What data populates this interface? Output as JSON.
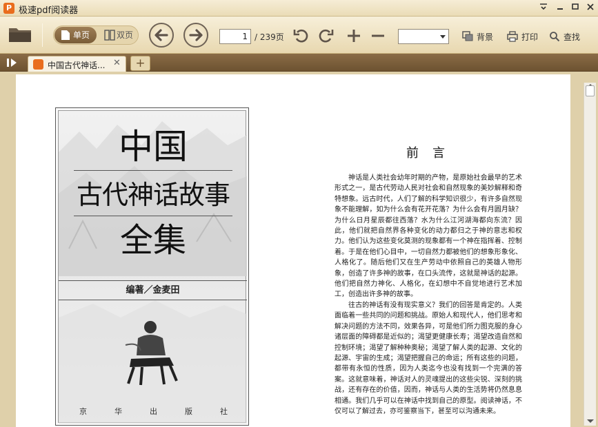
{
  "app": {
    "title": "极速pdf阅读器",
    "logo_color": "#e96d1d"
  },
  "window_controls": [
    "menu-icon",
    "minimize-icon",
    "maximize-icon",
    "close-icon"
  ],
  "toolbar": {
    "single_page_label": "单页",
    "double_page_label": "双页",
    "current_page": "1",
    "total_pages_label": "/ 239页",
    "background_label": "背景",
    "print_label": "打印",
    "find_label": "查找",
    "zoom_value": ""
  },
  "tabs": [
    {
      "label": "中国古代神话...",
      "active": true
    }
  ],
  "tab_add_label": "+",
  "document": {
    "cover": {
      "title_line1": "中国",
      "title_line2": "古代神话故事",
      "title_line3": "全集",
      "author": "编著／金麦田",
      "publisher_chars": [
        "京",
        "华",
        "出",
        "版",
        "社"
      ]
    },
    "preface": {
      "title": "前言",
      "paragraphs": [
        "神话是人类社会幼年时期的产物，是原始社会最早的艺术形式之一，是古代劳动人民对社会和自然现象的美妙解释和奇特想象。远古时代，人们了解的科学知识很少，有许多自然现象不能理解，如为什么会有花开花落？为什么会有月圆月缺？为什么日月星辰都往西落？水为什么江河湖海都向东流？因此，他们就把自然界各种变化的动力都归之于神的意志和权力。他们认为这些变化莫测的现象都有一个神在指挥着、控制着。于是在他们心目中，一切自然力都被他们的想象形象化、人格化了。随后他们又在生产劳动中依照自己的英雄人物形象，创造了许多神的故事，在口头流传，这就是神话的起源。他们把自然力神化、人格化，在幻想中不自觉地进行艺术加工，创造出许多神的故事。",
        "往古的神话有没有现实意义？我们的回答是肯定的。人类面临着一些共同的问题和挑战。原始人和现代人，他们思考和解决问题的方法不同，效果各异，可是他们所力图克服的身心诸层面的障碍都是近似的；渴望更健康长寿；渴望改造自然和控制环境；渴望了解种种奥秘；渴望了解人类的起源、文化的起源、宇宙的生成；渴望把握自己的命运；所有这些的问题，都带有永恒的性质，因为人类迄今也没有找到一个完满的答案。这就意味着，神话对人的灵魂提出的这些尖锐、深刻的挑战，还有存在的价值，因而，神话与人类的生活势将仍然息息相通。我们几乎可以在神话中找到自己的原型。阅读神话，不仅可以了解过去，亦可鉴察当下，甚至可以沟通未来。"
      ]
    }
  }
}
